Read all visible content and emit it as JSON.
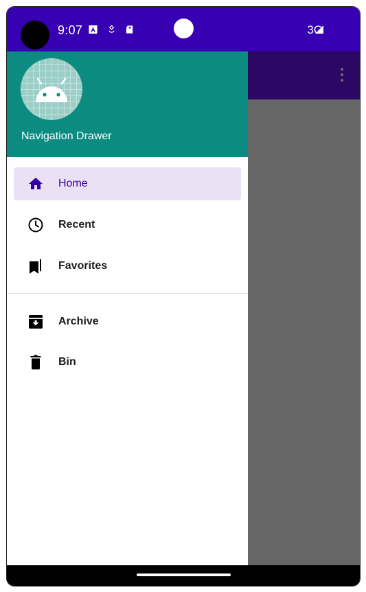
{
  "status_bar": {
    "time": "9:07",
    "network": "3G"
  },
  "drawer": {
    "title": "Navigation Drawer",
    "items": [
      {
        "label": "Home",
        "icon": "home-icon",
        "selected": true
      },
      {
        "label": "Recent",
        "icon": "clock-icon",
        "selected": false
      },
      {
        "label": "Favorites",
        "icon": "bookmarks-icon",
        "selected": false
      },
      {
        "label": "Archive",
        "icon": "archive-icon",
        "selected": false
      },
      {
        "label": "Bin",
        "icon": "trash-icon",
        "selected": false
      }
    ]
  },
  "colors": {
    "status_bar": "#3700b3",
    "drawer_header": "#0c8b80",
    "selected_bg": "#ebe1f4",
    "selected_text": "#3300a6",
    "scrim": "#666666"
  }
}
